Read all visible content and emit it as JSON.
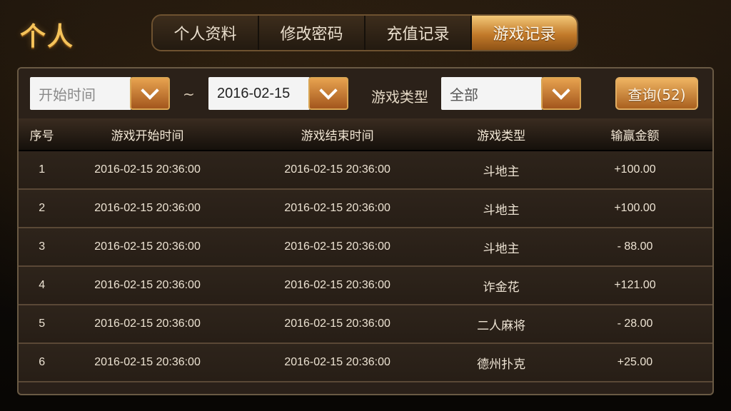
{
  "header": {
    "title": "个人"
  },
  "tabs": [
    {
      "label": "个人资料",
      "active": false
    },
    {
      "label": "修改密码",
      "active": false
    },
    {
      "label": "充值记录",
      "active": false
    },
    {
      "label": "游戏记录",
      "active": true
    }
  ],
  "filters": {
    "start_placeholder": "开始时间",
    "separator": "~",
    "end_value": "2016-02-15",
    "type_label": "游戏类型",
    "type_value": "全部",
    "query_label": "查询(52)"
  },
  "table": {
    "headers": [
      "序号",
      "游戏开始时间",
      "游戏结束时间",
      "游戏类型",
      "输赢金额"
    ],
    "rows": [
      [
        "1",
        "2016-02-15 20:36:00",
        "2016-02-15 20:36:00",
        "斗地主",
        "+100.00"
      ],
      [
        "2",
        "2016-02-15 20:36:00",
        "2016-02-15 20:36:00",
        "斗地主",
        "+100.00"
      ],
      [
        "3",
        "2016-02-15 20:36:00",
        "2016-02-15 20:36:00",
        "斗地主",
        "- 88.00"
      ],
      [
        "4",
        "2016-02-15 20:36:00",
        "2016-02-15 20:36:00",
        "诈金花",
        "+121.00"
      ],
      [
        "5",
        "2016-02-15 20:36:00",
        "2016-02-15 20:36:00",
        "二人麻将",
        "- 28.00"
      ],
      [
        "6",
        "2016-02-15 20:36:00",
        "2016-02-15 20:36:00",
        "德州扑克",
        "+25.00"
      ]
    ]
  },
  "colors": {
    "accent": "#f5c35a",
    "active_tab": "#c27a2a",
    "panel_bg": "#2a2019"
  }
}
